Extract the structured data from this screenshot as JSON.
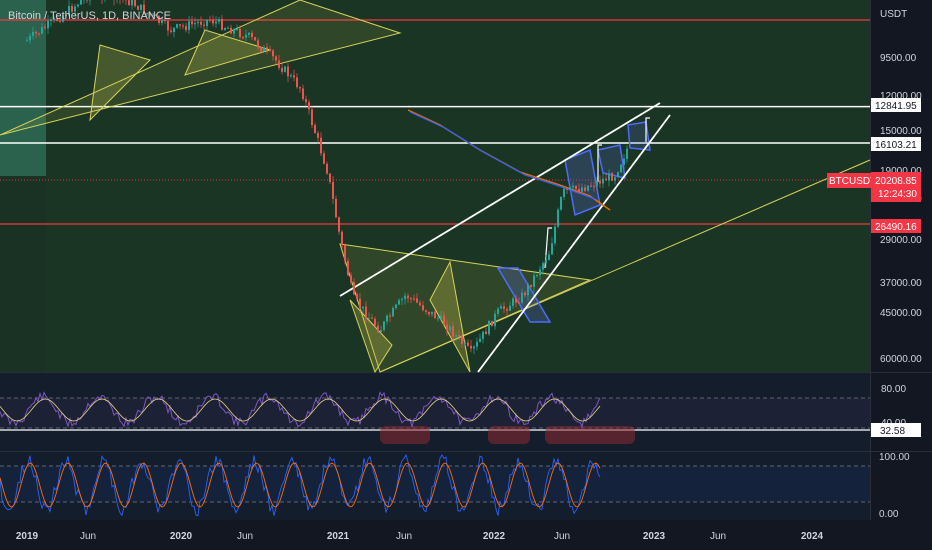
{
  "header": {
    "title": "Bitcoin / TetherUS, 1D, BINANCE",
    "currency": "USDT"
  },
  "price_axis": {
    "ticks": [
      "9500.00",
      "12000.00",
      "15000.00",
      "19000.00",
      "23000.00",
      "29000.00",
      "37000.00",
      "45000.00",
      "60000.00"
    ]
  },
  "price_tags": {
    "top_white": "12841.95",
    "mid_white": "16103.21",
    "symbol": "BTCUSDT",
    "current": "20208.85",
    "countdown": "12:24:30",
    "red": "26490.16"
  },
  "rsi": {
    "ticks": [
      "80.00",
      "40.00"
    ],
    "value": "32.58"
  },
  "stoch": {
    "ticks": [
      "100.00",
      "0.00"
    ]
  },
  "time_axis": [
    "2019",
    "Jun",
    "2020",
    "Jun",
    "2021",
    "Jun",
    "2022",
    "Jun",
    "2023",
    "Jun",
    "2024"
  ],
  "colors": {
    "background": "#131722",
    "up_candle": "#26a69a",
    "down_candle": "#ef5350",
    "red_line": "#f23645",
    "rsi_line": "#7e57c2",
    "stoch_k": "#2962ff",
    "stoch_d": "#ff6d00"
  },
  "chart_data": {
    "type": "candlestick",
    "title": "Bitcoin / TetherUS, 1D, BINANCE",
    "x_ticks": [
      "2019",
      "Jun",
      "2020",
      "Jun",
      "2021",
      "Jun",
      "2022",
      "Jun",
      "2023",
      "Jun",
      "2024"
    ],
    "y_scale": "inverted-log",
    "y_ticks": [
      9500,
      12000,
      15000,
      19000,
      23000,
      29000,
      37000,
      45000,
      60000
    ],
    "horizontal_lines": [
      12841.95,
      16103.21,
      26490.16
    ],
    "current_price": 20208.85,
    "price_path": [
      {
        "x": "2019-01",
        "y": 9000
      },
      {
        "x": "2019-04",
        "y": 8200
      },
      {
        "x": "2019-06",
        "y": 7600
      },
      {
        "x": "2019-09",
        "y": 7900
      },
      {
        "x": "2019-12",
        "y": 8700
      },
      {
        "x": "2020-03",
        "y": 8400
      },
      {
        "x": "2020-06",
        "y": 8900
      },
      {
        "x": "2020-08",
        "y": 9600
      },
      {
        "x": "2020-10",
        "y": 11500
      },
      {
        "x": "2020-12",
        "y": 19000
      },
      {
        "x": "2021-01",
        "y": 29000
      },
      {
        "x": "2021-02",
        "y": 41000
      },
      {
        "x": "2021-04",
        "y": 50000
      },
      {
        "x": "2021-06",
        "y": 40000
      },
      {
        "x": "2021-09",
        "y": 48000
      },
      {
        "x": "2021-11",
        "y": 58000
      },
      {
        "x": "2022-01",
        "y": 45000
      },
      {
        "x": "2022-03",
        "y": 40000
      },
      {
        "x": "2022-05",
        "y": 31000
      },
      {
        "x": "2022-06",
        "y": 22000
      },
      {
        "x": "2022-08",
        "y": 21000
      },
      {
        "x": "2022-10",
        "y": 19500
      },
      {
        "x": "2022-11",
        "y": 16500
      }
    ],
    "rsi": {
      "value": 32.58,
      "levels": [
        80,
        40
      ]
    },
    "stochastic": {
      "levels": [
        100,
        0
      ]
    }
  }
}
